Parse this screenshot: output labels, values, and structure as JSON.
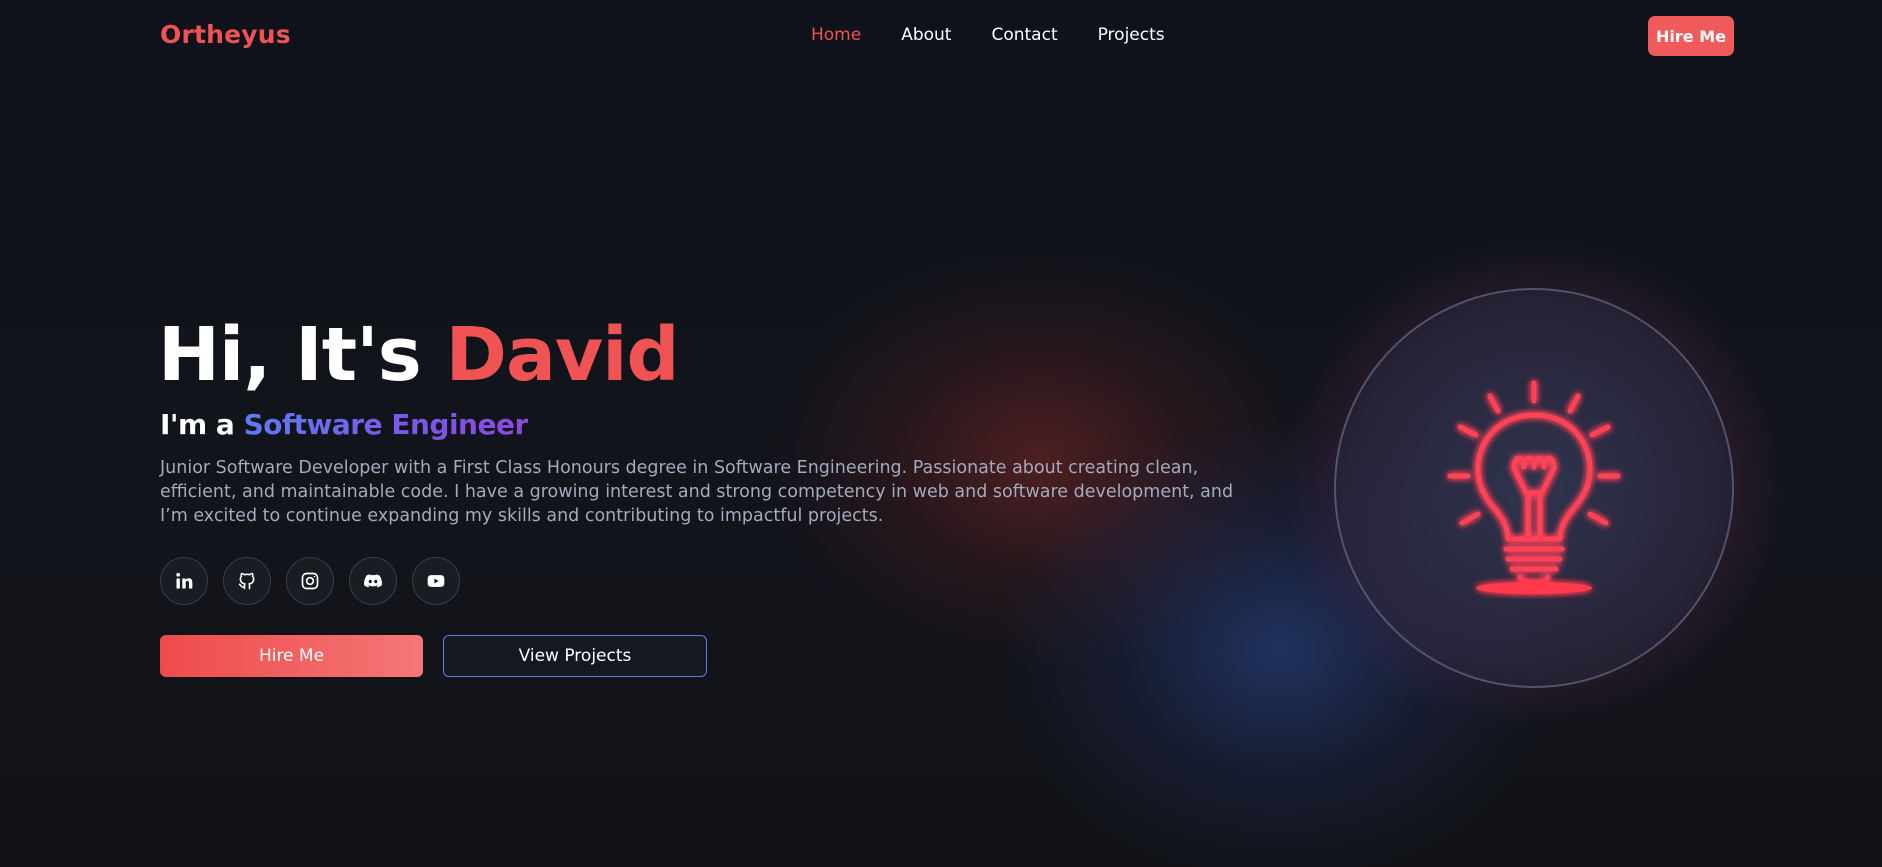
{
  "nav": {
    "logo": "Ortheyus",
    "links": [
      {
        "label": "Home",
        "active": true
      },
      {
        "label": "About",
        "active": false
      },
      {
        "label": "Contact",
        "active": false
      },
      {
        "label": "Projects",
        "active": false
      }
    ],
    "hire_label": "Hire Me"
  },
  "hero": {
    "greeting": "Hi, It's",
    "name": "David",
    "subtitle_prefix": "I'm a",
    "role": "Software Engineer",
    "description": "Junior Software Developer with a First Class Honours degree in Software Engineering. Passionate about creating clean, efficient, and maintainable code. I have a growing interest and strong competency in web and software development, and I’m excited to continue expanding my skills and contributing to impactful projects.",
    "socials": [
      {
        "icon": "linkedin-icon"
      },
      {
        "icon": "github-icon"
      },
      {
        "icon": "instagram-icon"
      },
      {
        "icon": "discord-icon"
      },
      {
        "icon": "youtube-icon"
      }
    ],
    "primary_button": "Hire Me",
    "secondary_button": "View Projects",
    "illustration": "lightbulb-icon"
  },
  "colors": {
    "background": "#111319",
    "accent": "#f05353",
    "role_gradient_start": "#5b7cf5",
    "role_gradient_end": "#8f49dc",
    "secondary_border": "#4e82e8",
    "bulb_glow": "#ff3b4e"
  }
}
